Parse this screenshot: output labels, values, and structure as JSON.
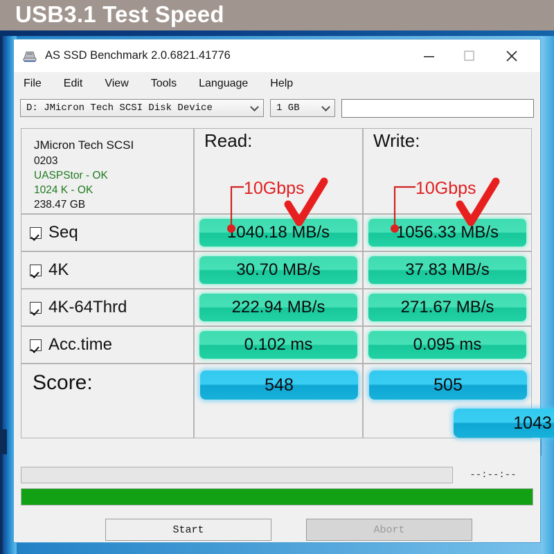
{
  "banner": {
    "title": "USB3.1 Test Speed"
  },
  "window": {
    "title": "AS SSD Benchmark 2.0.6821.41776",
    "icon": "hdd-icon",
    "controls": {
      "minimize": "—",
      "maximize": "□",
      "close": "✕"
    }
  },
  "menubar": {
    "items": [
      "File",
      "Edit",
      "View",
      "Tools",
      "Language",
      "Help"
    ]
  },
  "toolbar": {
    "drive": "D: JMicron Tech SCSI Disk Device",
    "size": "1 GB",
    "note_value": "",
    "note_placeholder": ""
  },
  "info": {
    "model": "JMicron Tech SCSI",
    "firmware": "0203",
    "driver": "UASPStor - OK",
    "alignment": "1024 K - OK",
    "capacity": "238.47 GB"
  },
  "columns": {
    "read": "Read:",
    "write": "Write:"
  },
  "rows": [
    {
      "name": "Seq",
      "checked": true,
      "read": "1040.18 MB/s",
      "write": "1056.33 MB/s"
    },
    {
      "name": "4K",
      "checked": true,
      "read": "30.70 MB/s",
      "write": "37.83 MB/s"
    },
    {
      "name": "4K-64Thrd",
      "checked": true,
      "read": "222.94 MB/s",
      "write": "271.67 MB/s"
    },
    {
      "name": "Acc.time",
      "checked": true,
      "read": "0.102 ms",
      "write": "0.095 ms"
    }
  ],
  "score": {
    "label": "Score:",
    "read": "548",
    "write": "505",
    "total": "1043"
  },
  "status": {
    "message": "",
    "elapsed": "--:--:--",
    "progress_percent": 100
  },
  "buttons": {
    "start": "Start",
    "abort": "Abort"
  },
  "annotations": {
    "read_label": "10Gbps",
    "write_label": "10Gbps",
    "color": "#e02020"
  },
  "colors": {
    "banner_bg": "#a1968f",
    "green_bar": "#3fdcb0",
    "blue_bar": "#33c9ef",
    "progress": "#12a114",
    "ok_text": "#1f7a1f"
  }
}
